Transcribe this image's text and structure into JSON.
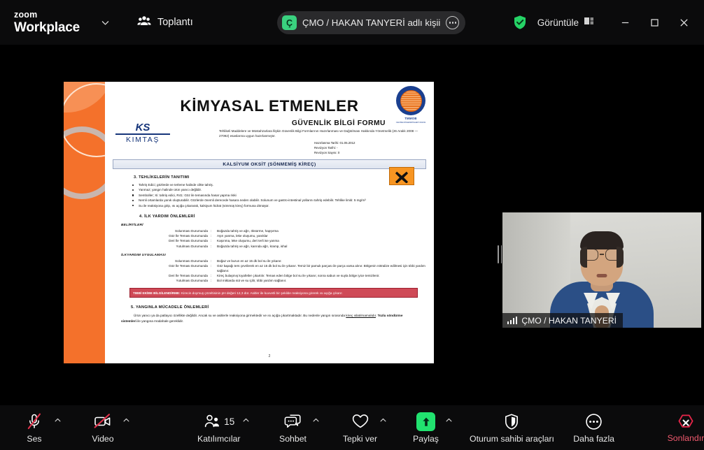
{
  "titlebar": {
    "brand_top": "zoom",
    "brand_bottom": "Workplace",
    "brand_caret_icon": "chevron-down-icon",
    "meeting_tab_icon": "people-group-icon",
    "meeting_tab_label": "Toplantı",
    "center_pill": {
      "avatar_initial": "Ç",
      "title": "ÇMO / HAKAN TANYERİ adlı kişii",
      "more_icon": "ellipsis-circle-icon"
    },
    "encryption_icon": "green-shield-check-icon",
    "view_label": "Görüntüle",
    "view_icon": "layout-view-icon",
    "minimize_icon": "minimize-icon",
    "maximize_icon": "maximize-icon",
    "close_icon": "close-icon"
  },
  "document": {
    "title": "KİMYASAL ETMENLER",
    "logo_company_mark": "KS",
    "logo_company_name": "KIMTAŞ",
    "tmmob_line1": "TMMOB",
    "tmmob_line2": "CEVRE MÜHENDİSLERİ ODASI",
    "form_title": "GÜVENLİK BİLGİ FORMU",
    "form_sub": "Tehlikeli Maddelere ve Müstahzarlara İlişkin Güvenlik Bilgi Formlarının Hazırlanması ve Dağıtılması Hakkında Yönetmelik (26 Aralık 2008 — 27092) esaslarına uygun hazırlanmıştır.",
    "meta_prepared": "Hazırlanma Tarihi: 01.05.2012",
    "meta_revision_date": "Revizyon Tarihi: -",
    "meta_revision_no": "Revizyon Sayısı: 0",
    "substance_band": "KALSİYUM OKSİT (SÖNMEMİŞ KİREÇ)",
    "section3_heading": "3.    TEHLİKELERİN TANITIMI",
    "section3_bullets": [
      "Tahriş Edici;  gözlerde ve terleme halinde ciltte tahriş.",
      "Yanmaz; yangın halinde ürün yanıcı değildir.",
      "Semboller;  Xi: tahriş edici,  R41: Göz ile temasında hasar yapma riski",
      "Nemli ortamlarda yanık oluşturabilir. Gözlerde önemli derecede hasara neden olabilir. Solunum ve gastro-intestinal yollarını tahriş edebilir. Tehlike limiti: 5 mg/m³",
      "Su ile reaksiyona girip, ısı açığa çıkararak,  kalsiyum hidrat (sönmüş kireç) formuna dönüşür."
    ],
    "hazard_symbol_icon": "x-hazard-pictogram",
    "section4_heading": "4.   İLK YARDIM ÖNLEMLERİ",
    "symptoms_heading": "BELİRTİLERİ",
    "symptoms_rows": [
      {
        "k": "Solunması Durumunda",
        "v": "Boğazda tahriş ve ağrı, öksürme, hapşırma"
      },
      {
        "k": "Göz İle Teması Durumunda",
        "v": "Aşırı yanma, leke oluşumu, yanıklar"
      },
      {
        "k": "Deri İle Teması Durumunda",
        "v": "Kaşınma, leke oluşumu, deri terli ise yanma"
      },
      {
        "k": "Yutulması Durumunda",
        "v": "Boğazda tahriş ve ağrı, karında ağrı, kramp, ishal"
      }
    ],
    "firstaid_heading": "İLKYARDIM UYGULAMASI",
    "firstaid_rows": [
      {
        "k": "Solunması Durumunda",
        "v": "Boğaz ve burun en az 15 dk bol su ile yıkanır."
      },
      {
        "k": "Göz İle Teması Durumunda",
        "v": "Göz kapağı ters çevrilerek en az 15 dk bol su ile yıkanır. Temiz bir pamuk parçası ile parça varsa alınır. Bölgenin nötralize edilmesi için tıbbi yardım sağlanır."
      },
      {
        "k": "Deri İle Teması Durumunda",
        "v": "Kireç bulaşmış kıyafetler çıkartılır. Temas eden bölge bol su ile yıkanır, sonra sabun ve suyla bölge iyice temizlenir."
      },
      {
        "k": "Yutulması Durumunda",
        "v": "Bol miktarda süt ve su içilir, tıbbi yardım sağlanır."
      }
    ],
    "warn_label": "TIBBİ EKİBE BİLGİLENDİRME:",
    "warn_text": " Kirecin doymuş çözeltisinin pH değeri 12,3 dür. Asitler ile kuvvetli bir şekilde reaksiyona girerek ısı açığa çıkarır.",
    "section5_heading": "5.    YANGINLA MÜCADELE ÖNLEMLERİ",
    "section5_text_a": "Ürün yanıcı ya da patlayıcı özellikte değildir. Ancak su ve asitlerle reaksiyona girmektedir ve ısı açığa çıkartmaktadır. Bu nedenle yangın sırasında ",
    "section5_underline": "kireç ıslatılmamalıdır",
    "section5_text_b": ". ",
    "section5_bold": "Tozlu söndürme sistemleri",
    "section5_text_c": " ile yangına müdahale gereklidir.",
    "page_number": "2"
  },
  "video_tile": {
    "name": "ÇMO / HAKAN TANYERİ",
    "signal_icon": "signal-bars-icon"
  },
  "toolbar": {
    "items": [
      {
        "label": "Ses",
        "icon": "microphone-muted-icon",
        "caret": true,
        "muted": true
      },
      {
        "label": "Video",
        "icon": "camera-muted-icon",
        "caret": true,
        "muted": true
      },
      {
        "label": "Katılımcılar",
        "icon": "participants-icon",
        "caret": true,
        "count": "15"
      },
      {
        "label": "Sohbet",
        "icon": "chat-bubble-icon",
        "caret": true
      },
      {
        "label": "Tepki ver",
        "icon": "heart-reaction-icon",
        "caret": true
      },
      {
        "label": "Paylaş",
        "icon": "share-screen-icon",
        "caret": true
      },
      {
        "label": "Oturum sahibi araçları",
        "icon": "host-tools-shield-icon",
        "caret": false
      },
      {
        "label": "Daha fazla",
        "icon": "more-ellipsis-icon",
        "caret": false
      },
      {
        "label": "Sonlandır",
        "icon": "end-call-icon",
        "caret": false
      }
    ]
  },
  "colors": {
    "share_green": "#21e16f",
    "end_red": "#f05a6e",
    "mute_red": "#e0304a",
    "doc_orange": "#f4712b",
    "accent_blue": "#1a3f8f"
  }
}
